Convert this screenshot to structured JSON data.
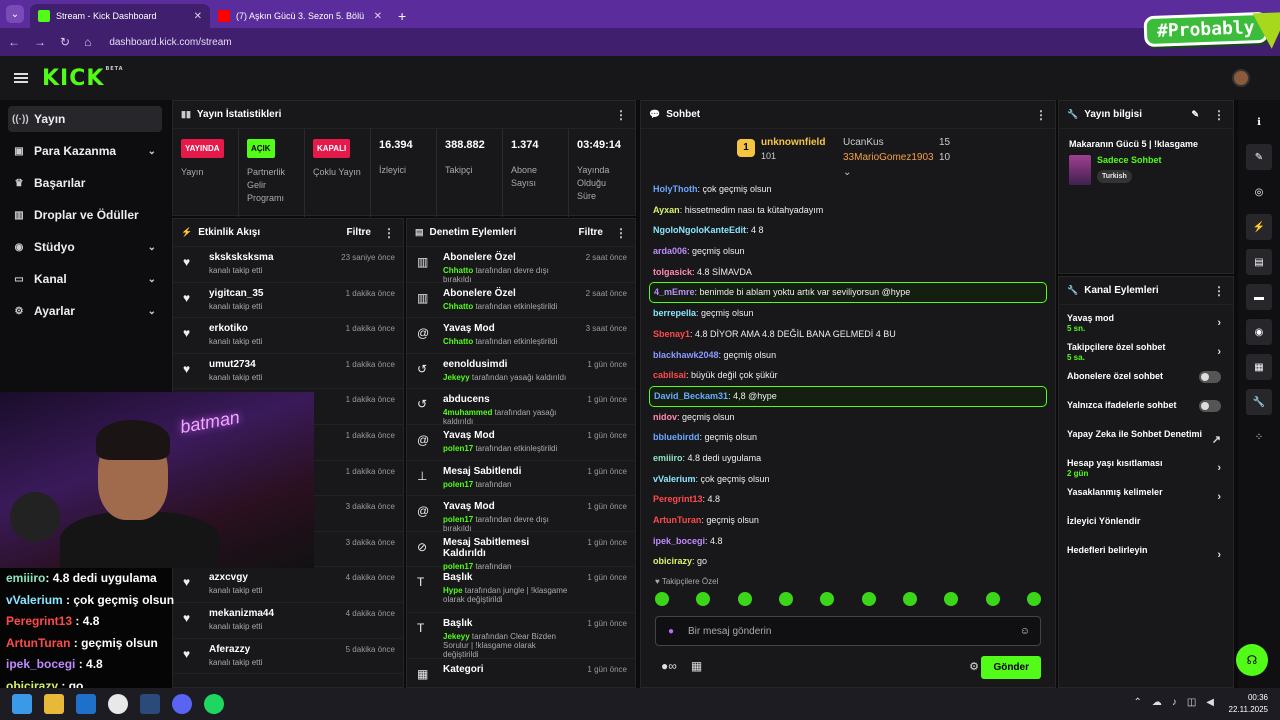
{
  "browser": {
    "tabs": [
      {
        "label": "Stream - Kick Dashboard",
        "favicon_color": "#53fc18"
      },
      {
        "label": "(7) Aşkın Gücü 3. Sezon 5. Bölü",
        "favicon_color": "#ff0000"
      }
    ],
    "url": "dashboard.kick.com/stream"
  },
  "overlay_brand": "#Probably",
  "logo": "KICK",
  "logo_beta": "BETA",
  "sidebar": {
    "items": [
      {
        "label": "Yayın",
        "icon": "stream-icon",
        "active": true
      },
      {
        "label": "Para Kazanma",
        "icon": "money-icon",
        "chevron": true
      },
      {
        "label": "Başarılar",
        "icon": "trophy-icon"
      },
      {
        "label": "Droplar ve Ödüller",
        "icon": "gift-icon"
      },
      {
        "label": "Stüdyo",
        "icon": "studio-icon",
        "chevron": true
      },
      {
        "label": "Kanal",
        "icon": "channel-icon",
        "chevron": true
      },
      {
        "label": "Ayarlar",
        "icon": "gear-icon",
        "chevron": true
      }
    ]
  },
  "stats": {
    "title": "Yayın İstatistikleri",
    "cells": [
      {
        "badge": "YAYINDA",
        "badge_color": "#e6194b",
        "label": "Yayın"
      },
      {
        "badge": "AÇIK",
        "badge_color": "#53fc18",
        "label": "Partnerlik Gelir Programı"
      },
      {
        "badge": "KAPALI",
        "badge_color": "#e6194b",
        "label": "Çoklu Yayın"
      },
      {
        "value": "16.394",
        "label": "İzleyici"
      },
      {
        "value": "388.882",
        "label": "Takipçi"
      },
      {
        "value": "1.374",
        "label": "Abone Sayısı"
      },
      {
        "value": "03:49:14",
        "label": "Yayında Olduğu Süre"
      }
    ]
  },
  "activity": {
    "title": "Etkinlik Akışı",
    "filter": "Filtre",
    "rows": [
      {
        "name": "sksksksksma",
        "sub": "kanalı takip etti",
        "time": "23 saniye önce"
      },
      {
        "name": "yigitcan_35",
        "sub": "kanalı takip etti",
        "time": "1 dakika önce"
      },
      {
        "name": "erkotiko",
        "sub": "kanalı takip etti",
        "time": "1 dakika önce"
      },
      {
        "name": "umut2734",
        "sub": "kanalı takip etti",
        "time": "1 dakika önce"
      },
      {
        "name": "",
        "sub": "",
        "time": "1 dakika önce"
      },
      {
        "name": "",
        "sub": "",
        "time": "1 dakika önce"
      },
      {
        "name": "",
        "sub": "",
        "time": "1 dakika önce"
      },
      {
        "name": "",
        "sub": "",
        "time": "3 dakika önce"
      },
      {
        "name": "",
        "sub": "",
        "time": "3 dakika önce"
      },
      {
        "name": "azxcvgy",
        "sub": "kanalı takip etti",
        "time": "4 dakika önce"
      },
      {
        "name": "mekanizma44",
        "sub": "kanalı takip etti",
        "time": "4 dakika önce"
      },
      {
        "name": "Aferazzy",
        "sub": "kanalı takip etti",
        "time": "5 dakika önce"
      }
    ]
  },
  "moderation": {
    "title": "Denetim Eylemleri",
    "filter": "Filtre",
    "rows": [
      {
        "action": "Abonelere Özel",
        "who": "Chhatto",
        "rest": " tarafından devre dışı bırakıldı",
        "time": "2 saat önce",
        "icon": "gift-icon"
      },
      {
        "action": "Abonelere Özel",
        "who": "Chhatto",
        "rest": " tarafından etkinleştirildi",
        "time": "2 saat önce",
        "icon": "gift-icon"
      },
      {
        "action": "Yavaş Mod",
        "who": "Chhatto",
        "rest": " tarafından etkinleştirildi",
        "time": "3 saat önce",
        "icon": "snail-icon"
      },
      {
        "action": "eenoldusimdi",
        "who": "Jekeyy",
        "rest": " tarafından yasağı kaldırıldı",
        "time": "1 gün önce",
        "icon": "undo-icon"
      },
      {
        "action": "abducens",
        "who": "4muhammed",
        "rest": " tarafından yasağı kaldırıldı",
        "time": "1 gün önce",
        "icon": "undo-icon"
      },
      {
        "action": "Yavaş Mod",
        "who": "polen17",
        "rest": " tarafından etkinleştirildi",
        "time": "1 gün önce",
        "icon": "snail-icon"
      },
      {
        "action": "Mesaj Sabitlendi",
        "who": "polen17",
        "rest": " tarafından",
        "time": "1 gün önce",
        "icon": "pin-icon"
      },
      {
        "action": "Yavaş Mod",
        "who": "polen17",
        "rest": " tarafından devre dışı bırakıldı",
        "time": "1 gün önce",
        "icon": "snail-icon"
      },
      {
        "action": "Mesaj Sabitlemesi Kaldırıldı",
        "who": "polen17",
        "rest": " tarafından",
        "time": "1 gün önce",
        "icon": "unpin-icon"
      },
      {
        "action": "Başlık",
        "who": "Hype",
        "rest": " tarafından jungle | !klasgame olarak değiştirildi",
        "time": "1 gün önce",
        "icon": "text-icon"
      },
      {
        "action": "Başlık",
        "who": "Jekeyy",
        "rest": " tarafından Clear Bizden Sorulur | !klasgame olarak değiştirildi",
        "time": "1 gün önce",
        "icon": "text-icon"
      },
      {
        "action": "Kategori",
        "who": "",
        "rest": "",
        "time": "1 gün önce",
        "icon": "category-icon"
      }
    ]
  },
  "chat": {
    "title": "Sohbet",
    "leaderboard": [
      {
        "name": "unknownfield",
        "count": "101",
        "color": "#f5c542"
      },
      {
        "name": "UcanKus",
        "count": "15",
        "color": "#cccccc"
      },
      {
        "name": "33MarioGomez1903",
        "count": "10",
        "color": "#f5a142"
      }
    ],
    "messages": [
      {
        "user": "HolyThoth",
        "color": "#6aa8ff",
        "text": ": çok geçmiş olsun"
      },
      {
        "user": "Ayxan",
        "color": "#d7f56a",
        "text": ": hissetmedim nası ta kütahyadayım"
      },
      {
        "user": "NgoloNgoloKanteEdit",
        "color": "#8ae6ff",
        "text": ": 4 8"
      },
      {
        "user": "arda006",
        "color": "#c08aff",
        "text": ": geçmiş olsun"
      },
      {
        "user": "tolgasick",
        "color": "#ff8ab0",
        "text": ": 4.8 SİMAVDA"
      },
      {
        "user": "4_mEmre",
        "color": "#c08aff",
        "text": ": benimde bi ablam yoktu artık var seviliyorsun @hype",
        "hl": true
      },
      {
        "user": "berrepella",
        "color": "#8ae6ff",
        "text": ": geçmiş olsun"
      },
      {
        "user": "Sbenay1",
        "color": "#ff4a4a",
        "text": ": 4.8 DİYOR AMA 4.8 DEĞİL BANA GELMEDİ 4 BU"
      },
      {
        "user": "blackhawk2048",
        "color": "#8a9aff",
        "text": ": geçmiş olsun"
      },
      {
        "user": "cabilsai",
        "color": "#ff4a4a",
        "text": ": büyük değil çok şükür"
      },
      {
        "user": "David_Beckam31",
        "color": "#6aa8ff",
        "text": ": 4,8 @hype",
        "hl": true
      },
      {
        "user": "nidov",
        "color": "#ff8ab0",
        "text": ": geçmiş olsun"
      },
      {
        "user": "bbluebirdd",
        "color": "#6aa8ff",
        "text": ": geçmiş olsun"
      },
      {
        "user": "emiiiro",
        "color": "#8ae6c0",
        "text": ": 4.8 dedi uygulama"
      },
      {
        "user": "vValerium",
        "color": "#8ae6ff",
        "text": ": çok geçmiş olsun"
      },
      {
        "user": "Peregrint13",
        "color": "#ff4a4a",
        "text": ": 4.8"
      },
      {
        "user": "ArtunTuran",
        "color": "#ff4a4a",
        "text": ": geçmiş olsun"
      },
      {
        "user": "ipek_bocegi",
        "color": "#c08aff",
        "text": ": 4.8"
      },
      {
        "user": "obicirazy",
        "color": "#d7f56a",
        "text": ": go"
      }
    ],
    "emote_section": "Takipçilere Özel",
    "placeholder": "Bir mesaj gönderin",
    "send": "Gönder"
  },
  "stream_info": {
    "title": "Yayın bilgisi",
    "stream_title": "Makaranın Gücü 5 | !klasgame",
    "category": "Sadece Sohbet",
    "tag": "Turkish"
  },
  "channel_actions": {
    "title": "Kanal Eylemleri",
    "items": [
      {
        "label": "Yavaş mod",
        "sub": "5 sn.",
        "kind": "arrow"
      },
      {
        "label": "Takipçilere özel sohbet",
        "sub": "5 sa.",
        "kind": "arrow"
      },
      {
        "label": "Abonelere özel sohbet",
        "sub": "",
        "kind": "toggle"
      },
      {
        "label": "Yalnızca ifadelerle sohbet",
        "sub": "",
        "kind": "toggle"
      },
      {
        "label": "Yapay Zeka ile Sohbet Denetimi",
        "sub": "",
        "kind": "external"
      },
      {
        "label": "Hesap yaşı kısıtlaması",
        "sub": "2 gün",
        "kind": "arrow"
      },
      {
        "label": "Yasaklanmış kelimeler",
        "sub": "",
        "kind": "arrow"
      },
      {
        "label": "İzleyici Yönlendir",
        "sub": "",
        "kind": "none"
      },
      {
        "label": "Hedefleri belirleyin",
        "sub": "",
        "kind": "arrow"
      }
    ]
  },
  "webcam": {
    "neon": "batman"
  },
  "overlay_chat": [
    {
      "user": "emiiiro",
      "color": "#8ae6c0",
      "text": ": 4.8 dedi uygulama"
    },
    {
      "user": "vValerium",
      "color": "#8ae6ff",
      "text": " : çok geçmiş olsun"
    },
    {
      "user": "Peregrint13",
      "color": "#ff4a4a",
      "text": " : 4.8"
    },
    {
      "user": "ArtunTuran",
      "color": "#ff4a4a",
      "text": " : geçmiş olsun"
    },
    {
      "user": "ipek_bocegi",
      "color": "#c08aff",
      "text": " : 4.8"
    },
    {
      "user": "obicirazy",
      "color": "#d7f56a",
      "text": " : go"
    }
  ],
  "taskbar": {
    "time": "00:36",
    "date": "22.11.2025"
  }
}
